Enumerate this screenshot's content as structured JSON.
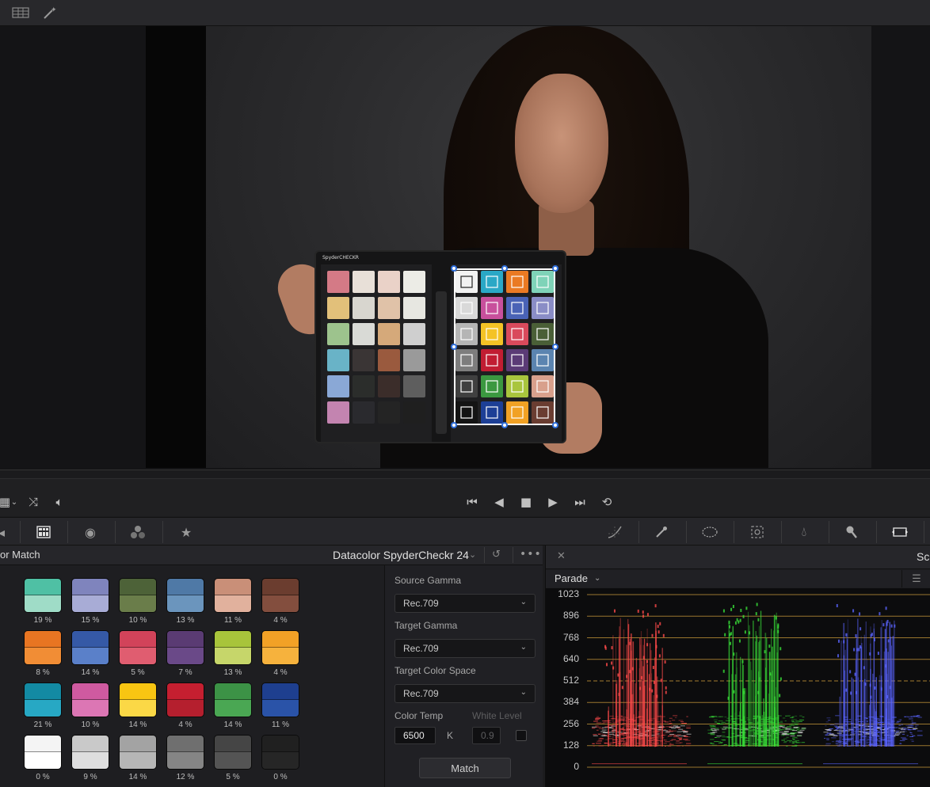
{
  "viewer": {
    "toolbar_icons": [
      "grid-view-icon",
      "magic-wand-icon"
    ]
  },
  "transport": {
    "left_icons": [
      "grid-icon",
      "chevron-down-icon",
      "shuffle-icon",
      "speaker-icon"
    ],
    "controls": [
      "skip-to-start-icon",
      "play-reverse-icon",
      "stop-icon",
      "play-icon",
      "skip-to-end-icon",
      "loop-icon"
    ]
  },
  "toolbar": {
    "left_tools": [
      "audio-icon",
      "color-chart-icon",
      "camera-raw-icon",
      "rgb-mixer-icon",
      "motion-effects-icon"
    ],
    "right_tools": [
      "curves-icon",
      "qualifier-eyedropper-icon",
      "window-icon",
      "tracker-icon",
      "blur-icon",
      "key-icon",
      "resize-icon"
    ]
  },
  "color_match": {
    "title": "or Match",
    "chart_name": "Datacolor SpyderCheckr 24",
    "swatches": [
      [
        {
          "top": "#4fc0a4",
          "bottom": "#9fdcc7",
          "pct": "19 %"
        },
        {
          "top": "#7f84bd",
          "bottom": "#a8acd6",
          "pct": "15 %"
        },
        {
          "top": "#4d6238",
          "bottom": "#6a7d4a",
          "pct": "10 %"
        },
        {
          "top": "#4f79a6",
          "bottom": "#6b95bd",
          "pct": "13 %"
        },
        {
          "top": "#c98f78",
          "bottom": "#e1b19d",
          "pct": "11 %"
        },
        {
          "top": "#6b3d2f",
          "bottom": "#834e3e",
          "pct": "4 %"
        }
      ],
      [
        {
          "top": "#e87522",
          "bottom": "#f18d35",
          "pct": "8 %"
        },
        {
          "top": "#3559a6",
          "bottom": "#5a80c9",
          "pct": "14 %"
        },
        {
          "top": "#d2435a",
          "bottom": "#e05d70",
          "pct": "5 %"
        },
        {
          "top": "#5a3b73",
          "bottom": "#6a4988",
          "pct": "7 %"
        },
        {
          "top": "#a8c43b",
          "bottom": "#c6d66a",
          "pct": "13 %"
        },
        {
          "top": "#f2a126",
          "bottom": "#f6b23d",
          "pct": "4 %"
        }
      ],
      [
        {
          "top": "#138aa3",
          "bottom": "#27a8c4",
          "pct": "21 %"
        },
        {
          "top": "#cf5aa0",
          "bottom": "#dc76b4",
          "pct": "10 %"
        },
        {
          "top": "#f8c512",
          "bottom": "#fbd846",
          "pct": "14 %"
        },
        {
          "top": "#c51f30",
          "bottom": "#b51f2e",
          "pct": "4 %"
        },
        {
          "top": "#3c9246",
          "bottom": "#4aa753",
          "pct": "14 %"
        },
        {
          "top": "#1e3f8f",
          "bottom": "#2a53a8",
          "pct": "11 %"
        }
      ],
      [
        {
          "top": "#f4f4f4",
          "bottom": "#ffffff",
          "pct": "0 %"
        },
        {
          "top": "#c9c9c9",
          "bottom": "#dedede",
          "pct": "9 %"
        },
        {
          "top": "#a3a3a3",
          "bottom": "#b6b6b6",
          "pct": "14 %"
        },
        {
          "top": "#6f6f6f",
          "bottom": "#858585",
          "pct": "12 %"
        },
        {
          "top": "#454545",
          "bottom": "#545454",
          "pct": "5 %"
        },
        {
          "top": "#202020",
          "bottom": "#262626",
          "pct": "0 %"
        }
      ]
    ],
    "settings": {
      "source_gamma_label": "Source Gamma",
      "source_gamma": "Rec.709",
      "target_gamma_label": "Target Gamma",
      "target_gamma": "Rec.709",
      "target_color_space_label": "Target Color Space",
      "target_color_space": "Rec.709",
      "color_temp_label": "Color Temp",
      "color_temp": "6500",
      "color_temp_unit": "K",
      "white_level_label": "White Level",
      "white_level": "0.9",
      "match_button": "Match"
    }
  },
  "scope": {
    "title": "Sc",
    "mode": "Parade",
    "y_ticks": [
      "1023",
      "896",
      "768",
      "640",
      "512",
      "384",
      "256",
      "128",
      "0"
    ]
  },
  "colors": {
    "accent_handle": "#2f6fdc",
    "scope_red": "#ff4a4a",
    "scope_green": "#38e038",
    "scope_blue": "#5a64ff",
    "grid_line": "#c99a3a"
  }
}
